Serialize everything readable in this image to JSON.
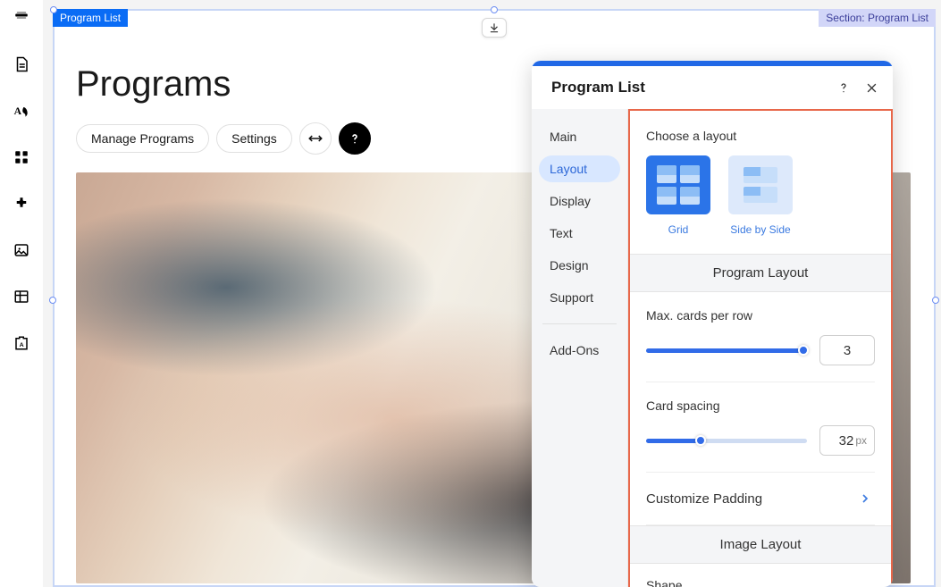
{
  "tags": {
    "top_left": "Program List",
    "top_right": "Section: Program List"
  },
  "page": {
    "title": "Programs",
    "toolbar": {
      "manage": "Manage Programs",
      "settings": "Settings"
    }
  },
  "panel": {
    "title": "Program List",
    "sidebar": {
      "main": "Main",
      "layout": "Layout",
      "display": "Display",
      "text": "Text",
      "design": "Design",
      "support": "Support",
      "addons": "Add-Ons"
    },
    "layout_section": {
      "choose_label": "Choose a layout",
      "grid_label": "Grid",
      "side_label": "Side by Side",
      "program_layout_header": "Program Layout",
      "max_cards_label": "Max. cards per row",
      "max_cards_value": "3",
      "card_spacing_label": "Card spacing",
      "card_spacing_value": "32",
      "card_spacing_unit": "px",
      "customize_padding_label": "Customize Padding",
      "image_layout_header": "Image Layout",
      "shape_label": "Shape"
    }
  }
}
